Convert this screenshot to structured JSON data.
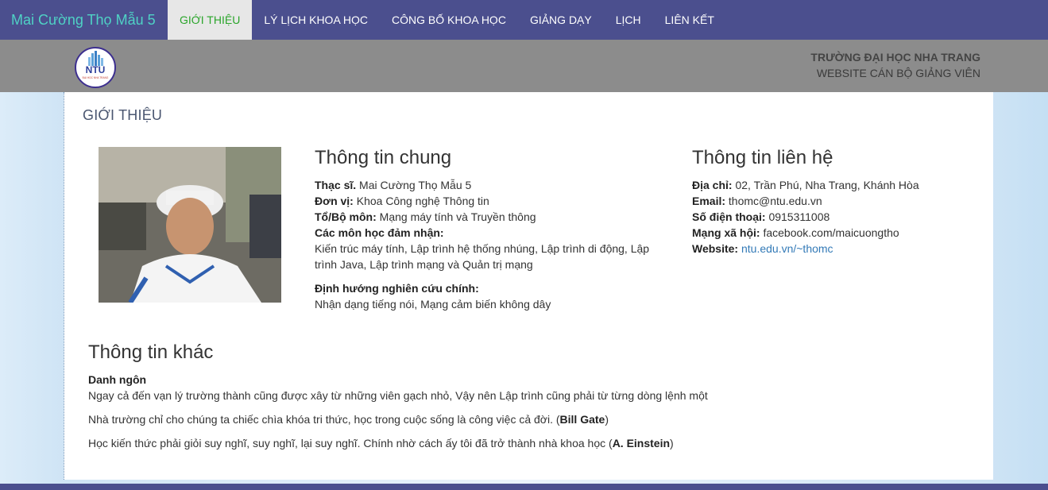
{
  "navbar": {
    "brand": "Mai Cường Thọ Mẫu 5",
    "items": [
      {
        "label": "GIỚI THIỆU",
        "active": true
      },
      {
        "label": "LÝ LỊCH KHOA HỌC"
      },
      {
        "label": "CÔNG BỐ KHOA HỌC"
      },
      {
        "label": "GIẢNG DẠY"
      },
      {
        "label": "LỊCH"
      },
      {
        "label": "LIÊN KẾT"
      }
    ]
  },
  "header": {
    "logo_text": "NTU",
    "logo_subtext": "ĐẠI HỌC NHA TRANG",
    "university": "TRƯỜNG ĐẠI HỌC NHA TRANG",
    "subtitle": "WEBSITE CÁN BỘ GIẢNG VIÊN"
  },
  "main": {
    "section_title": "GIỚI THIỆU",
    "general": {
      "heading": "Thông tin chung",
      "degree_label": "Thạc sĩ.",
      "degree_value": "Mai Cường Thọ Mẫu 5",
      "unit_label": "Đơn vị:",
      "unit_value": "Khoa Công nghệ Thông tin",
      "dept_label": "Tổ/Bộ môn:",
      "dept_value": "Mạng máy tính và Truyền thông",
      "courses_label": "Các môn học đảm nhận:",
      "courses_value": "Kiến trúc máy tính, Lập trình hệ thống nhúng, Lập trình di động, Lập trình Java, Lập trình mạng và Quản trị mạng",
      "research_label": "Định hướng nghiên cứu chính:",
      "research_value": "Nhận dạng tiếng nói, Mạng cảm biến không dây"
    },
    "contact": {
      "heading": "Thông tin liên hệ",
      "address_label": "Địa chỉ:",
      "address_value": "02, Trần Phú, Nha Trang, Khánh Hòa",
      "email_label": "Email:",
      "email_value": "thomc@ntu.edu.vn",
      "phone_label": "Số điện thoại:",
      "phone_value": "0915311008",
      "social_label": "Mạng xã hội:",
      "social_value": "facebook.com/maicuongtho",
      "website_label": "Website:",
      "website_value": "ntu.edu.vn/~thomc"
    },
    "other": {
      "heading": "Thông tin khác",
      "quotes_label": "Danh ngôn",
      "quote1": "Ngay cả đến vạn lý trường thành cũng được xây từ những viên gạch nhỏ, Vậy nên Lập trình cũng phải từ từng dòng lệnh một",
      "quote2_text": "Nhà trường chỉ cho chúng ta chiếc chìa khóa tri thức, học trong cuộc sống là công việc cả đời. (",
      "quote2_author": "Bill Gate",
      "quote2_close": ")",
      "quote3_text": " Học kiến thức phải giỏi suy nghĩ, suy nghĩ, lại suy nghĩ. Chính nhờ cách ấy tôi đã trở thành nhà khoa học (",
      "quote3_author": "A. Einstein",
      "quote3_close": ")"
    }
  },
  "colors": {
    "navbar": "#4b4f8e",
    "brand": "#4fd2c5",
    "active_tab_bg": "#e7e7e7",
    "active_tab_text": "#2aa52a",
    "header_band": "#8c8c8c",
    "link": "#337ab7"
  }
}
